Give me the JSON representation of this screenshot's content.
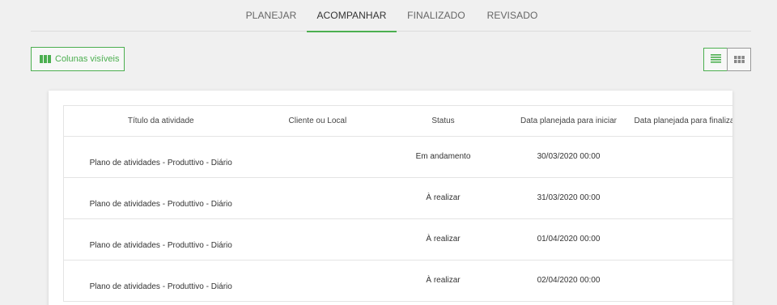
{
  "tabs": [
    {
      "label": "PLANEJAR"
    },
    {
      "label": "ACOMPANHAR"
    },
    {
      "label": "FINALIZADO"
    },
    {
      "label": "REVISADO"
    }
  ],
  "toolbar": {
    "columns_button": "Colunas visíveis",
    "accent_color": "#4caf50",
    "list_view_icon": "list-icon",
    "grid_view_icon": "grid-icon"
  },
  "table": {
    "headers": [
      "Título da atividade",
      "Cliente ou Local",
      "Status",
      "Data planejada para iniciar",
      "Data planejada para finalizar"
    ],
    "rows": [
      {
        "title": "Plano de atividades - Produttivo - Diário",
        "client": "",
        "status": "Em andamento",
        "start": "30/03/2020 00:00",
        "end": ""
      },
      {
        "title": "Plano de atividades - Produttivo - Diário",
        "client": "",
        "status": "À realizar",
        "start": "31/03/2020 00:00",
        "end": ""
      },
      {
        "title": "Plano de atividades - Produttivo - Diário",
        "client": "",
        "status": "À realizar",
        "start": "01/04/2020 00:00",
        "end": ""
      },
      {
        "title": "Plano de atividades - Produttivo - Diário",
        "client": "",
        "status": "À realizar",
        "start": "02/04/2020 00:00",
        "end": ""
      }
    ]
  }
}
